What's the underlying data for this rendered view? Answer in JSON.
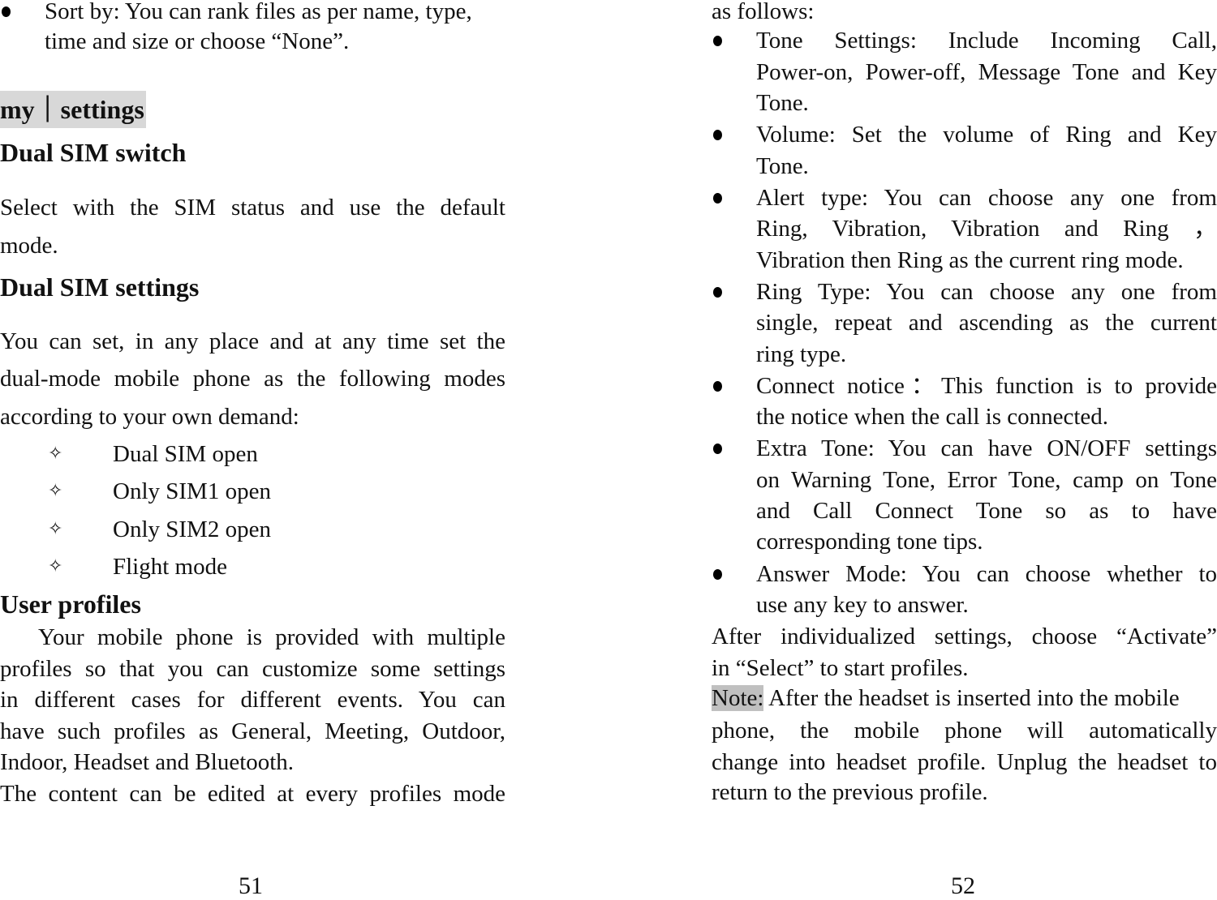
{
  "left_page": {
    "sort_by_bullet": {
      "line1": "Sort by: You can rank files as per name, type,",
      "line2": "time and size or choose “None”."
    },
    "section_heading": "my｜settings",
    "dual_sim_switch": {
      "heading": "Dual SIM switch",
      "line1": "Select with the SIM status and use the default",
      "line2": "mode."
    },
    "dual_sim_settings": {
      "heading": "Dual SIM settings",
      "line1": "You can set, in any place and at any time set the",
      "line2": "dual-mode mobile phone as the following modes",
      "line3": "according to your own demand:",
      "modes": [
        "Dual SIM open",
        "Only SIM1 open",
        "Only SIM2 open",
        "Flight mode"
      ],
      "mode_icon": "✧"
    },
    "user_profiles": {
      "heading": "User profiles",
      "lines": [
        "Your mobile phone is provided with multiple",
        "profiles so that you can customize some settings",
        "in different cases for different events. You can",
        "have such profiles as General, Meeting, Outdoor,",
        "Indoor, Headset and Bluetooth.",
        "The content can be edited at every profiles mode"
      ]
    },
    "page_number": "51"
  },
  "right_page": {
    "intro": "as follows:",
    "bullets": [
      {
        "lines": [
          "Tone Settings: Include Incoming Call,",
          "Power-on, Power-off, Message Tone and Key",
          "Tone."
        ]
      },
      {
        "lines": [
          "Volume: Set the volume of Ring and Key",
          "Tone."
        ]
      },
      {
        "lines": [
          "Alert type: You can choose any one from",
          "Ring, Vibration, Vibration and Ring ，",
          "Vibration then Ring as the current ring mode."
        ]
      },
      {
        "lines": [
          "Ring Type: You can choose any one from",
          "single, repeat and ascending as the current",
          "ring type."
        ]
      },
      {
        "lines": [
          "Connect notice：This function is to provide",
          "the notice when the call is connected."
        ]
      },
      {
        "lines": [
          "Extra Tone: You can have ON/OFF settings",
          "on Warning Tone, Error Tone, camp on Tone",
          "and Call Connect Tone so as to have",
          "corresponding tone tips."
        ]
      },
      {
        "lines": [
          "Answer Mode: You can choose whether to",
          "use any key to answer."
        ]
      }
    ],
    "after": {
      "line1": "After individualized settings, choose “Activate”",
      "line2": "in “Select” to start profiles."
    },
    "note": {
      "label": "Note:",
      "line1_rest": " After the headset is inserted into the mobile",
      "line2": "phone, the mobile phone will automatically",
      "line3": "change into headset profile. Unplug the headset to",
      "line4": "return to the previous profile."
    },
    "page_number": "52"
  }
}
